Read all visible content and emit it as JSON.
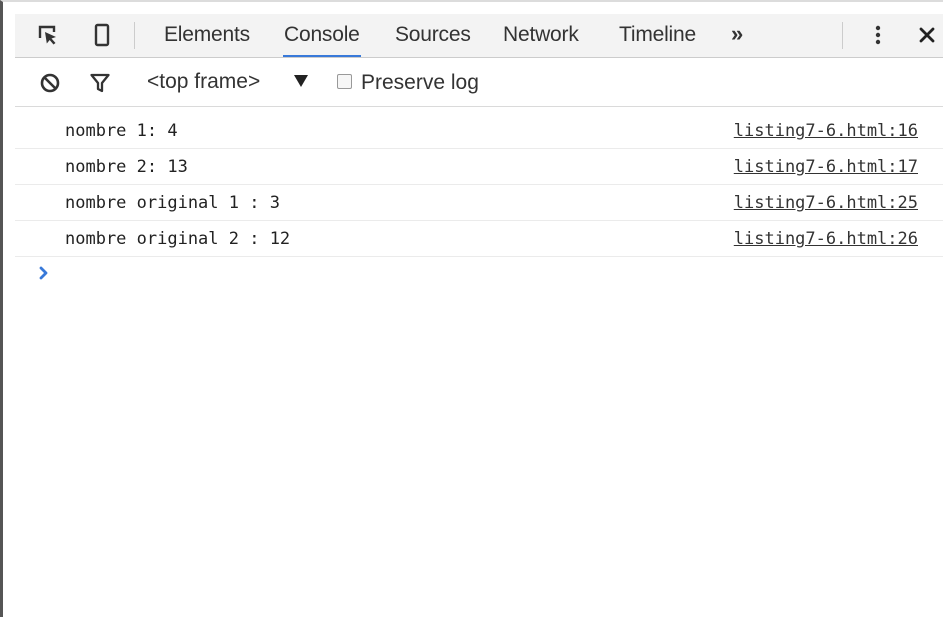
{
  "toolbar_icons": {
    "inspect": "inspect-element-icon",
    "device": "device-mode-icon",
    "menu": "kebab-menu-icon",
    "close": "close-icon"
  },
  "tabs": [
    {
      "label": "Elements",
      "active": false
    },
    {
      "label": "Console",
      "active": true
    },
    {
      "label": "Sources",
      "active": false
    },
    {
      "label": "Network",
      "active": false
    },
    {
      "label": "Timeline",
      "active": false
    }
  ],
  "more_tabs_label": "»",
  "console_toolbar": {
    "clear_icon": "clear-console-icon",
    "filter_icon": "filter-icon",
    "context": "<top frame>",
    "preserve_log_label": "Preserve log",
    "preserve_log_checked": false
  },
  "messages": [
    {
      "text": "nombre 1: 4",
      "source": "listing7-6.html:16"
    },
    {
      "text": "nombre 2: 13",
      "source": "listing7-6.html:17"
    },
    {
      "text": "nombre original 1 : 3",
      "source": "listing7-6.html:25"
    },
    {
      "text": "nombre original 2 : 12",
      "source": "listing7-6.html:26"
    }
  ],
  "prompt": {
    "icon": "prompt-chevron-icon",
    "value": ""
  },
  "colors": {
    "active_tab_underline": "#3879d9",
    "prompt_chevron": "#3879d9",
    "tabbar_bg": "#f3f3f3"
  }
}
